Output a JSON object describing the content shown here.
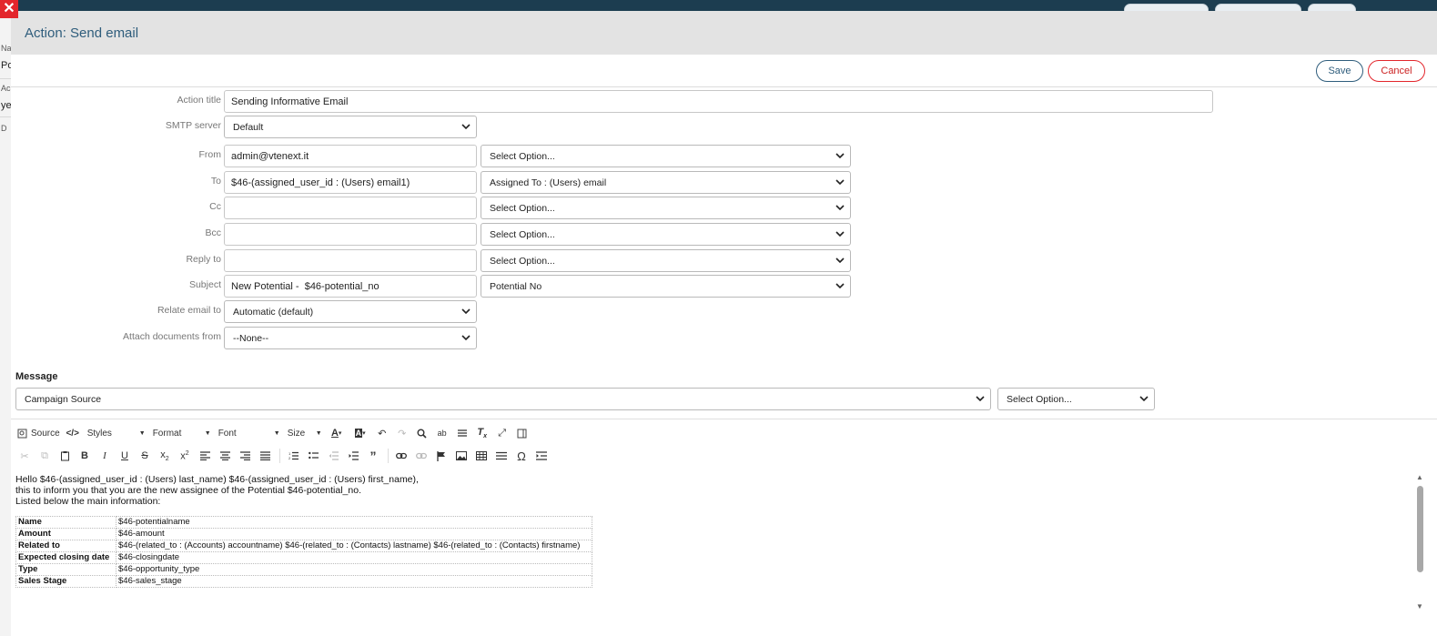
{
  "window": {
    "title": "Action: Send email"
  },
  "toolbar": {
    "save_label": "Save",
    "cancel_label": "Cancel"
  },
  "background": {
    "side_texts": [
      "Na",
      "Po",
      "Ac",
      "ye",
      "D"
    ]
  },
  "form": {
    "action_title": {
      "label": "Action title",
      "value": "Sending Informative Email"
    },
    "smtp_server": {
      "label": "SMTP server",
      "value": "Default"
    },
    "from": {
      "label": "From",
      "value": "admin@vtenext.it",
      "option": "Select Option..."
    },
    "to": {
      "label": "To",
      "value": "$46-(assigned_user_id : (Users) email1)",
      "option": "Assigned To : (Users) email"
    },
    "cc": {
      "label": "Cc",
      "value": "",
      "option": "Select Option..."
    },
    "bcc": {
      "label": "Bcc",
      "value": "",
      "option": "Select Option..."
    },
    "reply_to": {
      "label": "Reply to",
      "value": "",
      "option": "Select Option..."
    },
    "subject": {
      "label": "Subject",
      "value": "New Potential -  $46-potential_no",
      "option": "Potential No"
    },
    "relate_email_to": {
      "label": "Relate email to",
      "value": "Automatic (default)"
    },
    "attach_documents_from": {
      "label": "Attach documents from",
      "value": "--None--"
    }
  },
  "message": {
    "label": "Message",
    "field_select": "Campaign Source",
    "option_select": "Select Option..."
  },
  "editor": {
    "toolbar": {
      "source": "Source",
      "styles": "Styles",
      "format": "Format",
      "font": "Font",
      "size": "Size"
    },
    "body_lines": [
      "Hello $46-(assigned_user_id : (Users) last_name) $46-(assigned_user_id : (Users) first_name),",
      "this to inform you that you are the new assignee of the Potential $46-potential_no.",
      "Listed below the main information:"
    ],
    "table": [
      {
        "key": "Name",
        "value": "$46-potentialname"
      },
      {
        "key": "Amount",
        "value": "$46-amount"
      },
      {
        "key": "Related to",
        "value": "$46-(related_to : (Accounts) accountname) $46-(related_to : (Contacts) lastname) $46-(related_to : (Contacts) firstname)"
      },
      {
        "key": "Expected closing date",
        "value": "$46-closingdate"
      },
      {
        "key": "Type",
        "value": "$46-opportunity_type"
      },
      {
        "key": "Sales Stage",
        "value": "$46-sales_stage"
      }
    ]
  },
  "colors": {
    "accent": "#2f5d7c",
    "danger": "#e3262c",
    "header_bg": "#e3e3e3"
  }
}
